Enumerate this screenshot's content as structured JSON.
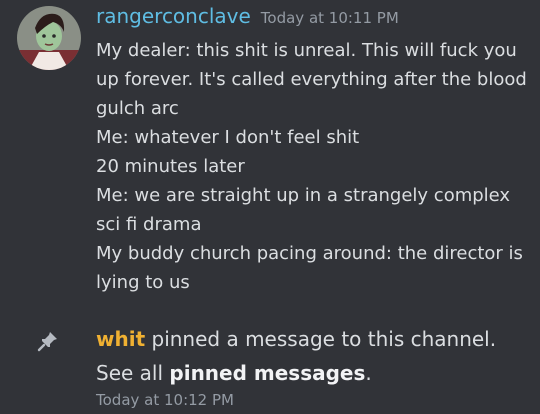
{
  "message": {
    "username": "rangerconclave",
    "timestamp": "Today at 10:11 PM",
    "lines": [
      "My dealer: this shit is unreal. This will fuck you up forever. It's called everything after the blood gulch arc",
      "Me: whatever I don't feel shit",
      "20 minutes later",
      "Me: we are straight up in a strangely complex sci fi drama",
      "My buddy church pacing around: the director is lying to us"
    ],
    "username_color": "#5fbde3"
  },
  "system": {
    "actor": "whit",
    "text": " pinned a message to this channel.",
    "see_all_prefix": "See all ",
    "pinned_link": "pinned messages",
    "see_all_suffix": ".",
    "timestamp": "Today at 10:12 PM",
    "actor_color": "#f0b132"
  },
  "icons": {
    "avatar": "avatar-image",
    "pin": "pin-icon"
  }
}
